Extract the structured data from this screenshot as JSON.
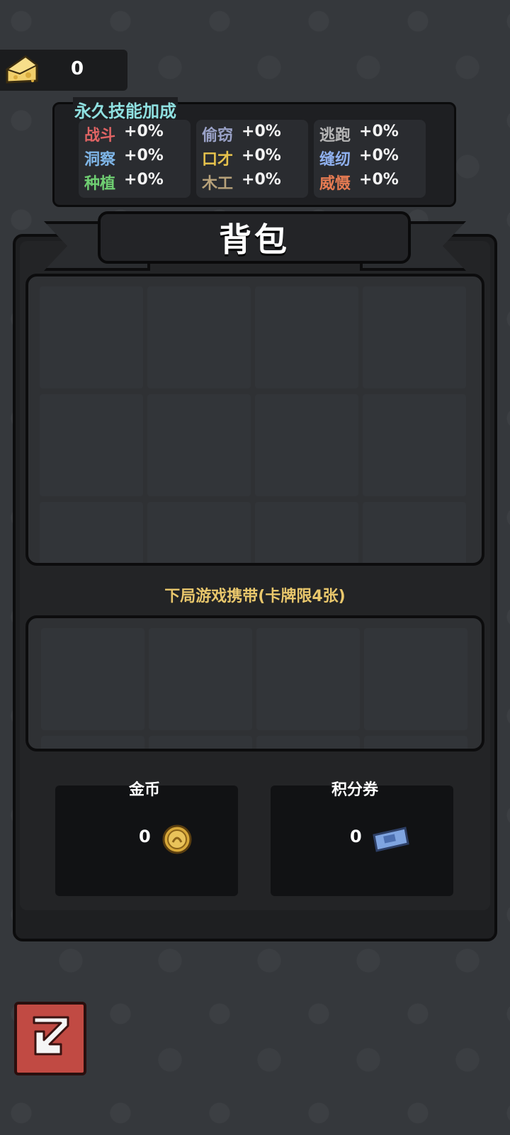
{
  "cheese": {
    "count": "0",
    "icon": "cheese-icon"
  },
  "skills": {
    "title": "永久技能加成",
    "items": [
      {
        "name": "战斗",
        "value": "+0%",
        "color": "#e06464"
      },
      {
        "name": "洞察",
        "value": "+0%",
        "color": "#7fb6e8"
      },
      {
        "name": "种植",
        "value": "+0%",
        "color": "#6fcf72"
      },
      {
        "name": "偷窃",
        "value": "+0%",
        "color": "#9ba3c9"
      },
      {
        "name": "口才",
        "value": "+0%",
        "color": "#e6c24c"
      },
      {
        "name": "木工",
        "value": "+0%",
        "color": "#b8a27a"
      },
      {
        "name": "逃跑",
        "value": "+0%",
        "color": "#b6b6b6"
      },
      {
        "name": "缝纫",
        "value": "+0%",
        "color": "#8fb0ee"
      },
      {
        "name": "威慑",
        "value": "+0%",
        "color": "#e67b52"
      }
    ]
  },
  "backpack": {
    "title": "背包",
    "carry_label": "下局游戏携带(卡牌限4张)"
  },
  "currency": {
    "gold": {
      "label": "金币",
      "value": "0",
      "icon": "gold-coin-icon"
    },
    "points": {
      "label": "积分券",
      "value": "0",
      "icon": "ticket-icon"
    }
  },
  "back_button": {
    "icon": "return-arrow-icon"
  }
}
